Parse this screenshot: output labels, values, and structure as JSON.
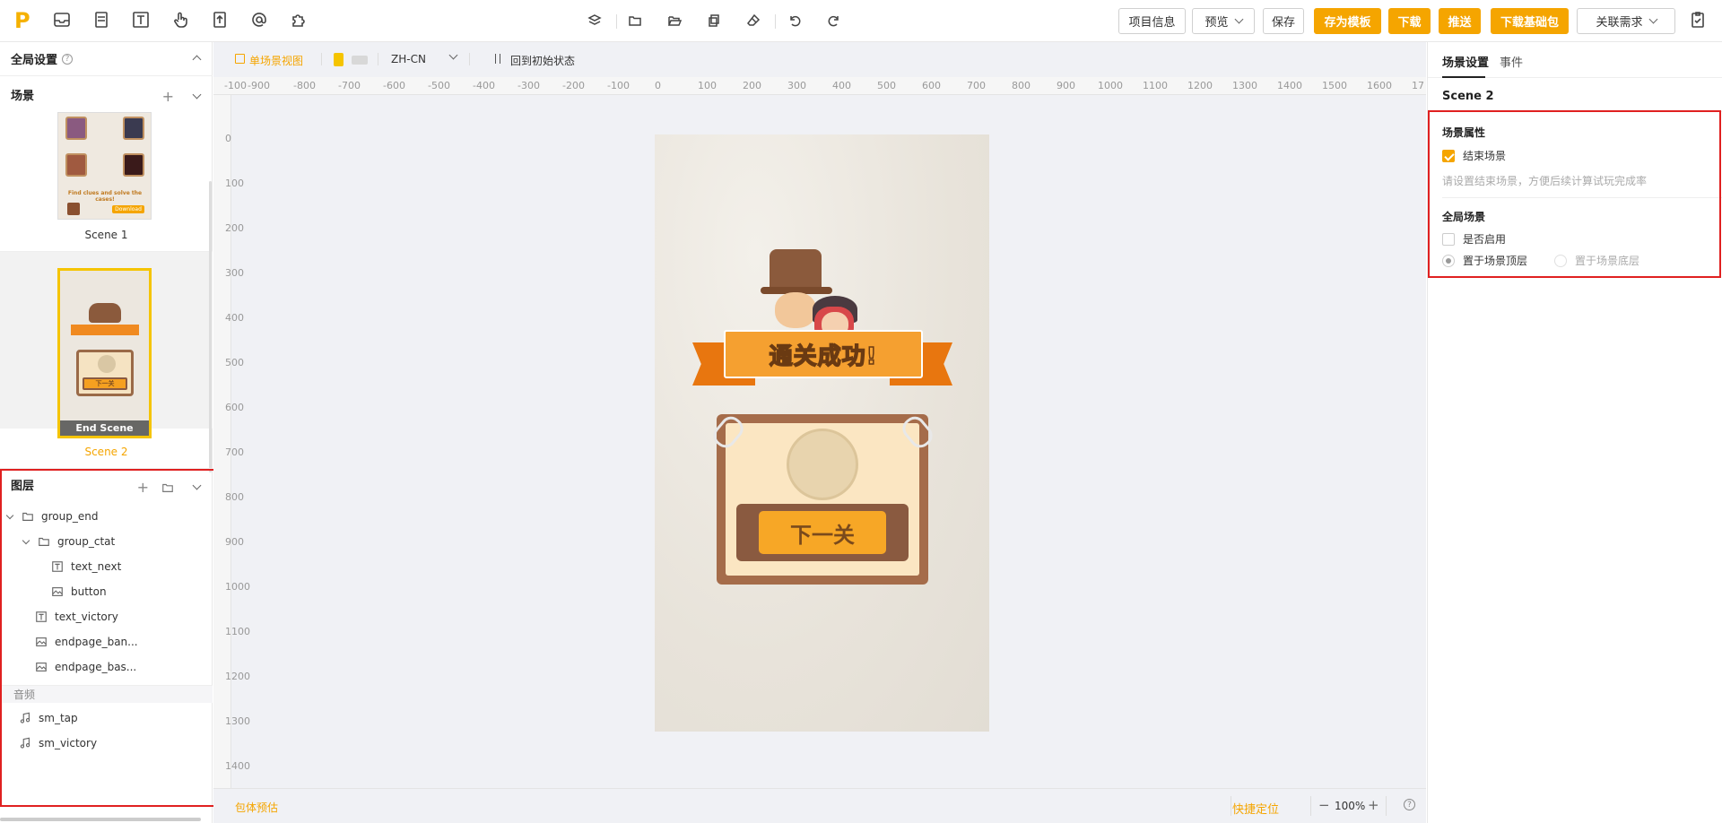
{
  "toolbar": {
    "logo": "P",
    "buttons": {
      "project_info": "项目信息",
      "preview": "预览",
      "save": "保存",
      "save_template": "存为模板",
      "download": "下载",
      "push": "推送",
      "download_base": "下载基础包",
      "link_requirement": "关联需求"
    }
  },
  "left": {
    "global_settings": "全局设置",
    "scenes_title": "场景",
    "scene1_label": "Scene 1",
    "scene2_label": "Scene 2",
    "end_scene_badge": "End Scene",
    "scene1_thumb_text": "Find clues and solve the cases!",
    "scene1_thumb_download": "Download",
    "scene2_thumb_next": "下一关",
    "layers_title": "图层",
    "layers": [
      {
        "label": "group_end"
      },
      {
        "label": "group_ctat"
      },
      {
        "label": "text_next"
      },
      {
        "label": "button"
      },
      {
        "label": "text_victory"
      },
      {
        "label": "endpage_ban..."
      },
      {
        "label": "endpage_bas..."
      }
    ],
    "audio_title": "音频",
    "audio": [
      {
        "label": "sm_tap"
      },
      {
        "label": "sm_victory"
      }
    ]
  },
  "canvas": {
    "view_mode": "单场景视图",
    "language": "ZH-CN",
    "reset": "回到初始状态",
    "ruler_top": [
      "-100",
      "-900",
      "-800",
      "-700",
      "-600",
      "-500",
      "-400",
      "-300",
      "-200",
      "-100",
      "0",
      "100",
      "200",
      "300",
      "400",
      "500",
      "600",
      "700",
      "800",
      "900",
      "1000",
      "1100",
      "1200",
      "1300",
      "1400",
      "1500",
      "1600",
      "17"
    ],
    "ruler_left": [
      "0",
      "100",
      "200",
      "300",
      "400",
      "500",
      "600",
      "700",
      "800",
      "900",
      "1000",
      "1100",
      "1200",
      "1300",
      "1400"
    ],
    "game_banner": "通关成功!",
    "game_button": "下一关",
    "bottom_left": "包体预估",
    "quick_locate": "快捷定位",
    "zoom": "100%",
    "zoom_minus": "−",
    "zoom_plus": "+",
    "help": "?"
  },
  "right": {
    "tabs": [
      "场景设置",
      "事件"
    ],
    "scene_name": "Scene 2",
    "scene_props_title": "场景属性",
    "end_scene_label": "结束场景",
    "end_scene_checked": true,
    "end_scene_hint": "请设置结束场景，方便后续计算试玩完成率",
    "global_scene_title": "全局场景",
    "enable_label": "是否启用",
    "place_top": "置于场景顶层",
    "place_bottom": "置于场景底层"
  },
  "colors": {
    "accent": "#f5a500",
    "highlight": "#e02020"
  }
}
